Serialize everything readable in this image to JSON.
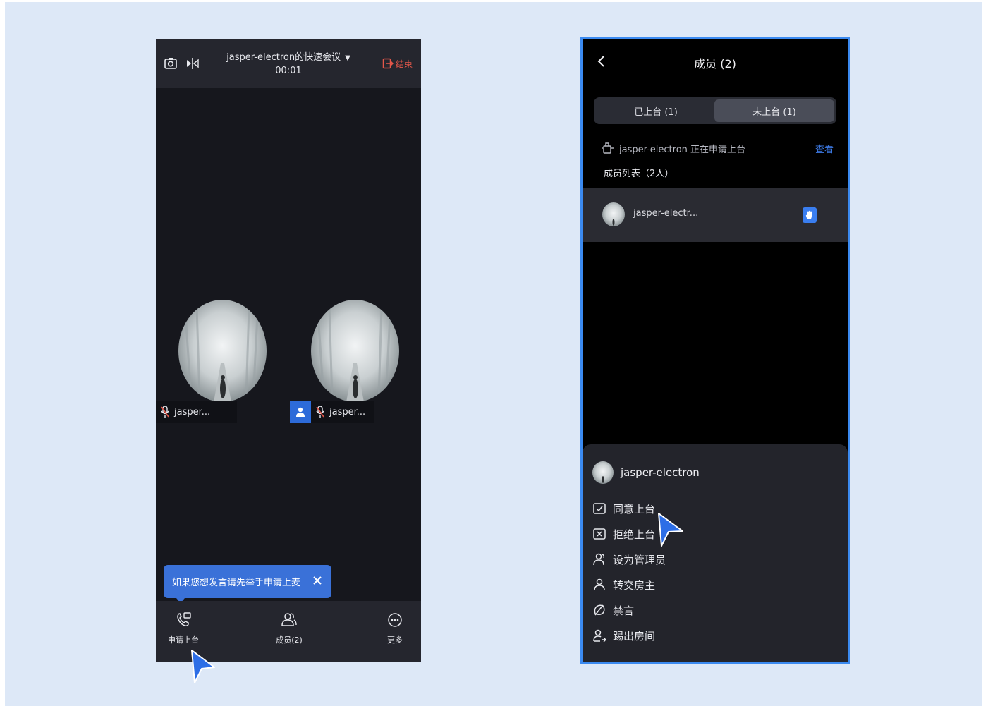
{
  "left_phone": {
    "header": {
      "title": "jasper-electron的快速会议",
      "caret": "▼",
      "timer": "00:01",
      "end_label": "结束"
    },
    "tiles": [
      {
        "name": "jasper..."
      },
      {
        "name": "jasper..."
      }
    ],
    "tooltip": {
      "text": "如果您想发言请先举手申请上麦"
    },
    "footer": {
      "items": [
        {
          "label": "申请上台",
          "icon": "phone-apply-icon"
        },
        {
          "label": "成员(2)",
          "icon": "members-icon"
        },
        {
          "label": "更多",
          "icon": "more-icon"
        }
      ]
    }
  },
  "right_phone": {
    "header": {
      "title": "成员 (2)"
    },
    "segment": {
      "tabs": [
        {
          "label": "已上台 (1)",
          "active": false
        },
        {
          "label": "未上台 (1)",
          "active": true
        }
      ]
    },
    "request": {
      "text": "jasper-electron 正在申请上台",
      "view_label": "查看"
    },
    "list_heading": "成员列表（2人）",
    "member": {
      "name": "jasper-electr..."
    },
    "sheet": {
      "username": "jasper-electron",
      "actions": [
        {
          "label": "同意上台",
          "icon": "approve-stage-icon"
        },
        {
          "label": "拒绝上台",
          "icon": "reject-stage-icon"
        },
        {
          "label": "设为管理员",
          "icon": "admin-icon"
        },
        {
          "label": "转交房主",
          "icon": "transfer-host-icon"
        },
        {
          "label": "禁言",
          "icon": "mute-icon"
        },
        {
          "label": "踢出房间",
          "icon": "kick-out-icon"
        }
      ]
    }
  },
  "colors": {
    "page_bg": "#dde8f7",
    "accent_blue": "#3a71d8",
    "end_red": "#e5574a",
    "frame_blue": "#3b8af0"
  }
}
